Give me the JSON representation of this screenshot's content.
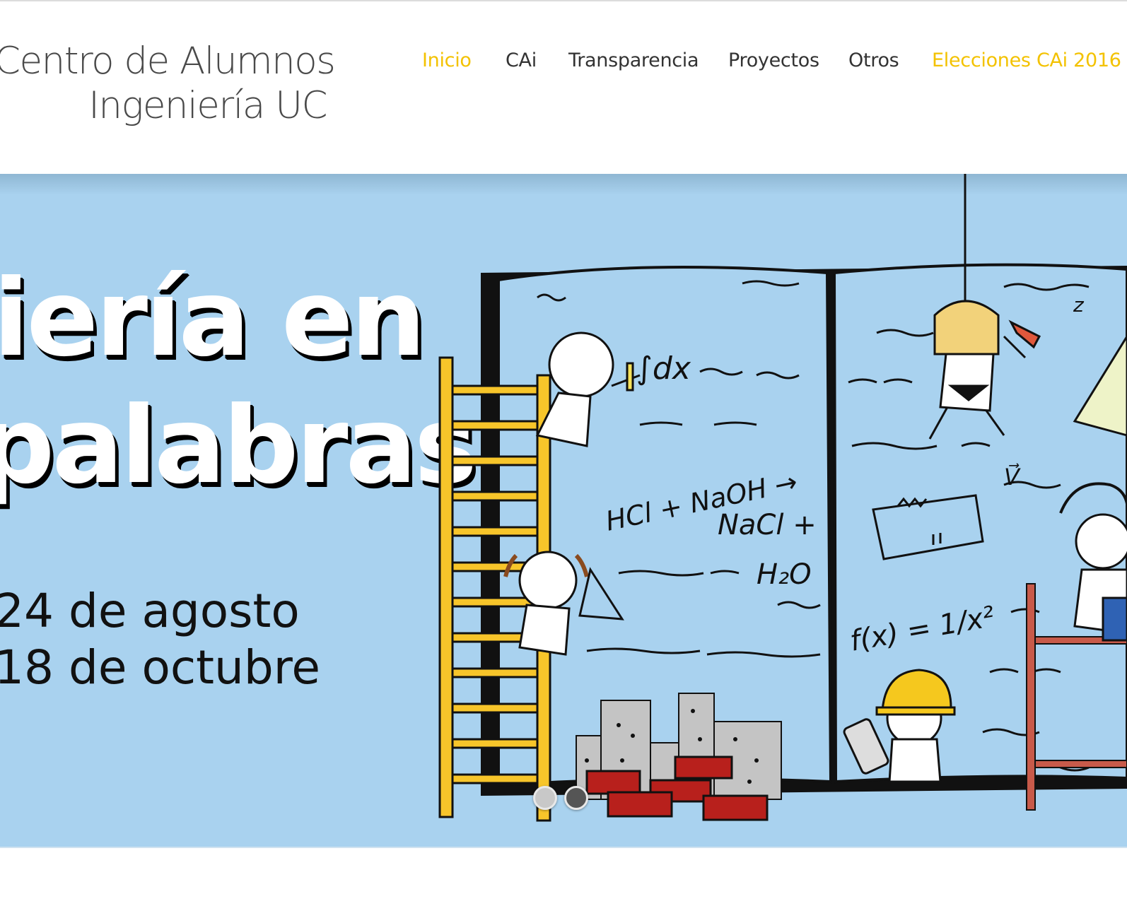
{
  "logo": {
    "line1": "Centro de Alumnos",
    "line2": "Ingeniería UC"
  },
  "nav": {
    "items": [
      {
        "label": "Inicio"
      },
      {
        "label": "CAi"
      },
      {
        "label": "Transparencia"
      },
      {
        "label": "Proyectos"
      },
      {
        "label": "Otros"
      },
      {
        "label": "Elecciones CAi 2016"
      }
    ],
    "active_color": "#f3c200"
  },
  "hero": {
    "headline_line1": "iería en",
    "headline_line2": "palabras",
    "date_line1": "24 de agosto",
    "date_line2": "18 de octubre",
    "background_color": "#a9d2ef",
    "board_text": {
      "integral": "∫dx",
      "reaction_1": "HCl + NaOH →",
      "reaction_2": "NaCl +",
      "reaction_3": "H₂O",
      "function": "f(x) = 1/x²",
      "vector": "V⃗",
      "axis": "z"
    },
    "slider_dots": 2
  },
  "icons": [
    "ladder-icon",
    "book-icon",
    "hard-hat-icon",
    "brick-icon",
    "building-icon",
    "hammer-icon",
    "calculator-icon"
  ]
}
